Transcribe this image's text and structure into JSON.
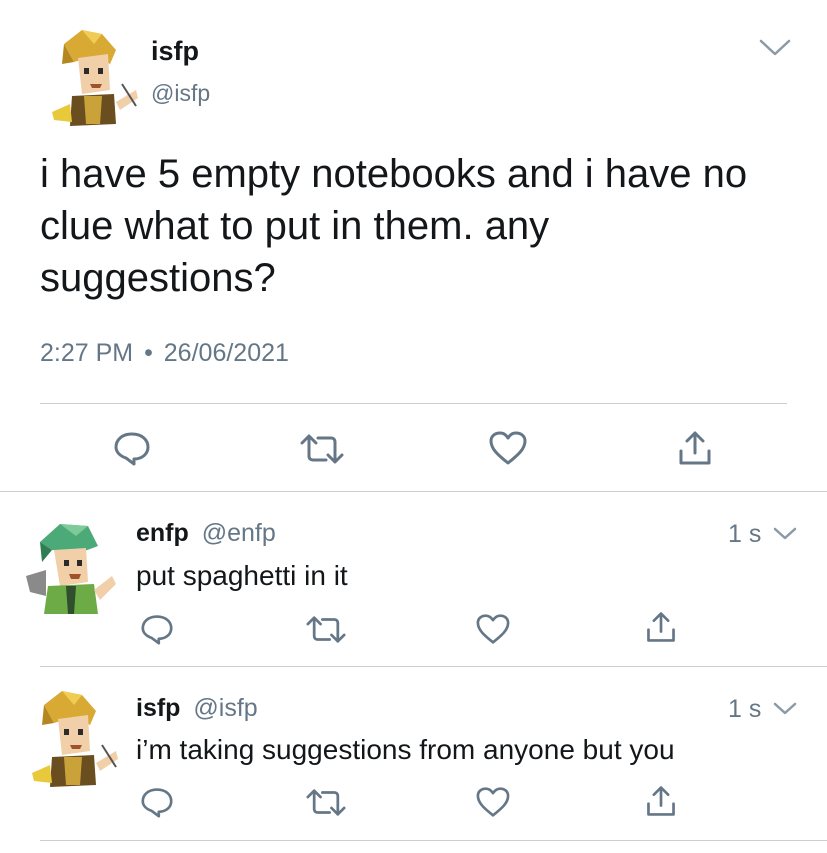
{
  "main_tweet": {
    "display_name": "isfp",
    "handle": "@isfp",
    "text_lines": [
      "i have 5 empty notebooks and i have no",
      "clue what to put in them. any",
      "suggestions?"
    ],
    "time": "2:27 PM",
    "separator": "•",
    "date": "26/06/2021"
  },
  "replies": [
    {
      "display_name": "enfp",
      "handle": "@enfp",
      "age": "1 s",
      "text": "put spaghetti in it"
    },
    {
      "display_name": "isfp",
      "handle": "@isfp",
      "age": "1 s",
      "text": "i’m taking suggestions from anyone but you"
    }
  ],
  "icons": {
    "chevron": "chevron-down-icon",
    "reply": "reply-icon",
    "retweet": "retweet-icon",
    "like": "heart-icon",
    "share": "share-icon"
  },
  "colors": {
    "text": "#14171a",
    "muted": "#657786",
    "divider": "#c9ced3",
    "avatar_isfp": "#d4a73a",
    "avatar_enfp": "#4caa78"
  }
}
